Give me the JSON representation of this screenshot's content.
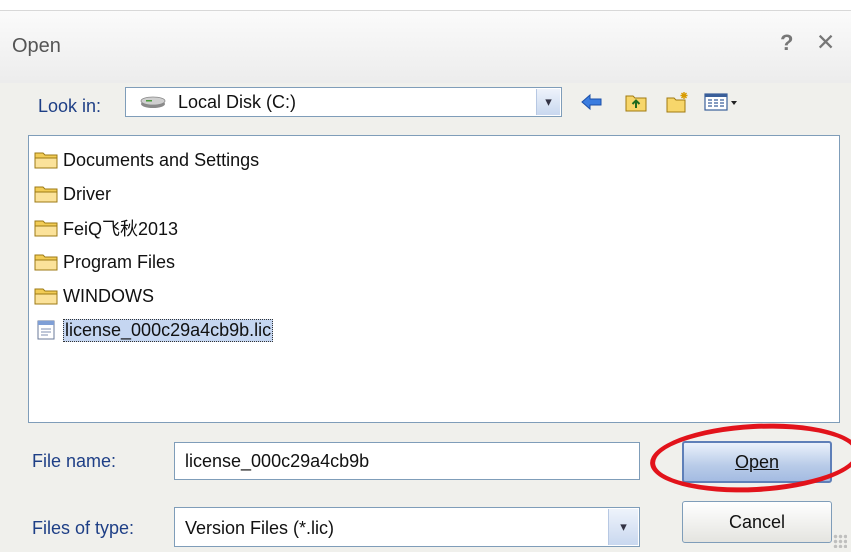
{
  "window": {
    "title": "Open",
    "help_label": "?",
    "close_label": "✕"
  },
  "look_in": {
    "label": "Look in:",
    "value": "Local Disk (C:)",
    "arrow": "▾"
  },
  "toolbar": {
    "icons": [
      "back-arrow-icon",
      "up-folder-icon",
      "new-folder-icon",
      "view-menu-icon"
    ]
  },
  "files": [
    {
      "name": "Documents and Settings",
      "type": "folder"
    },
    {
      "name": "Driver",
      "type": "folder"
    },
    {
      "name": "FeiQ飞秋2013",
      "type": "folder"
    },
    {
      "name": "Program Files",
      "type": "folder"
    },
    {
      "name": "WINDOWS",
      "type": "folder"
    },
    {
      "name": "license_000c29a4cb9b.lic",
      "type": "file",
      "selected": true
    }
  ],
  "file_name": {
    "label": "File name:",
    "value": "license_000c29a4cb9b"
  },
  "file_type": {
    "label": "Files of type:",
    "value": "Version Files (*.lic)",
    "arrow": "▾"
  },
  "buttons": {
    "open": "Open",
    "cancel": "Cancel"
  },
  "colors": {
    "annotation": "#e2131b",
    "label_text": "#1e3f86",
    "selection": "#c5d6f1"
  }
}
